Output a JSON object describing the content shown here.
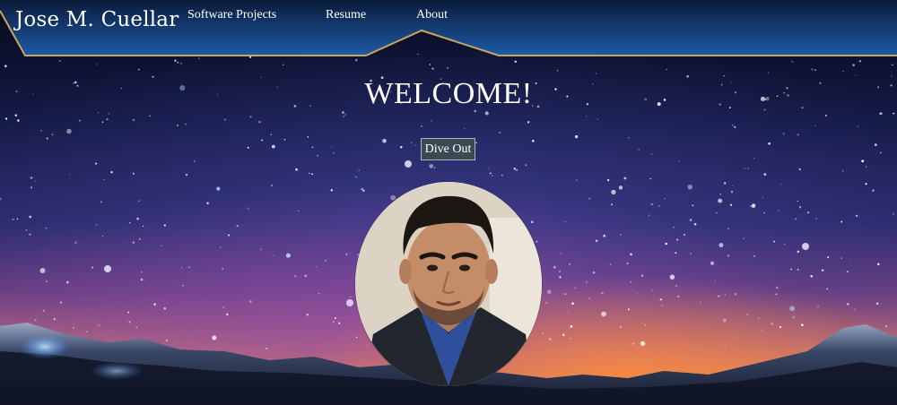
{
  "header": {
    "brand": "Jose M. Cuellar",
    "nav": [
      {
        "label": "Software Projects"
      },
      {
        "label": "Resume"
      },
      {
        "label": "About"
      }
    ]
  },
  "hero": {
    "heading": "WELCOME!",
    "button_label": "Dive Out",
    "avatar_alt": "Profile photo"
  },
  "colors": {
    "header_top": "#0a1b3a",
    "header_bottom": "#1e5aa8",
    "header_border": "#c8a75a",
    "button_bg": "#3b4a52"
  }
}
